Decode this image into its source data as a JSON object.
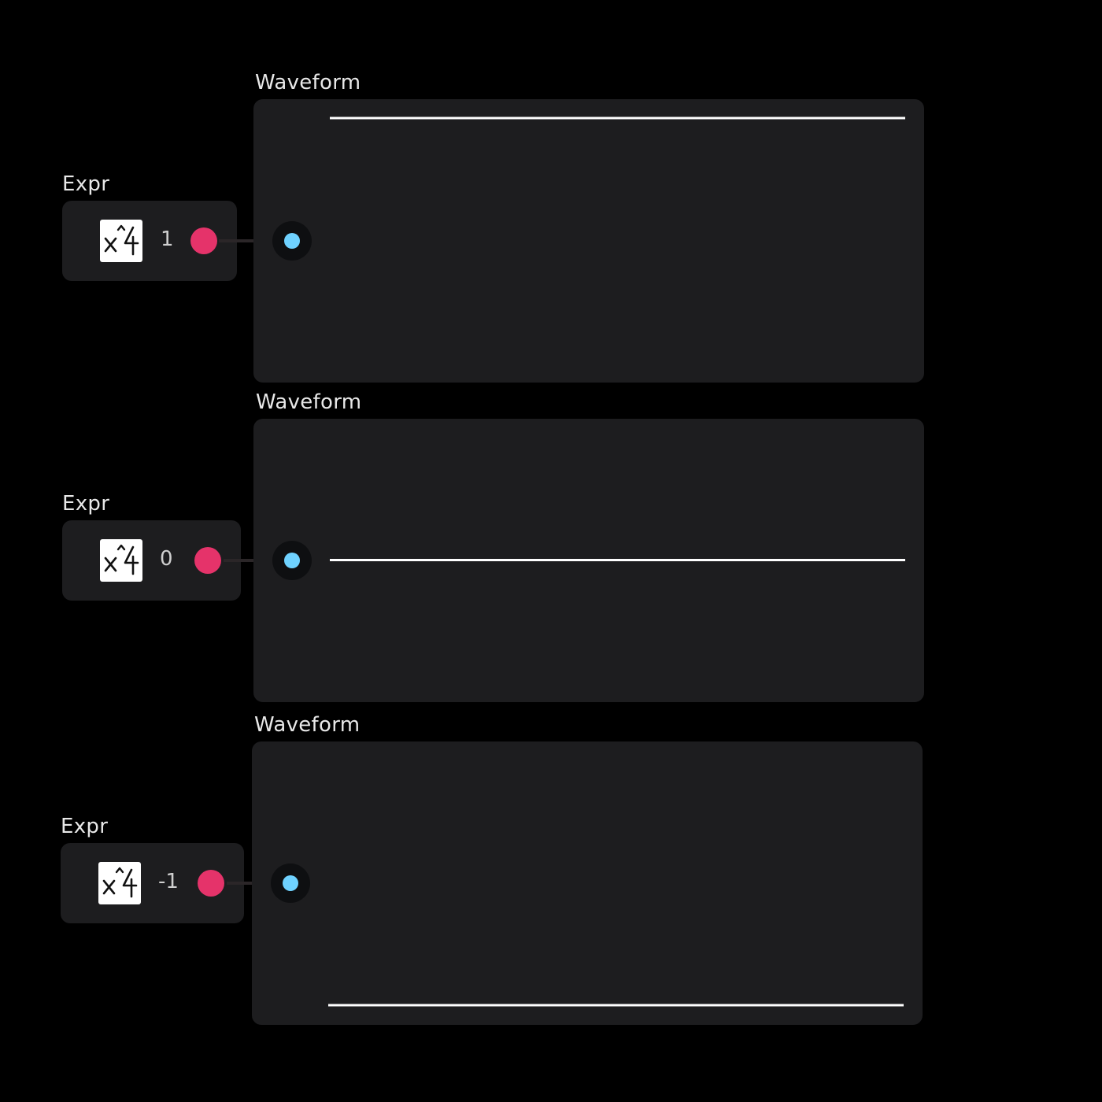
{
  "colors": {
    "background": "#000000",
    "node_bg": "#1d1d1f",
    "output_port": "#e5336a",
    "input_port": "#6fd2ff",
    "waveform_line": "#ffffff"
  },
  "rows": [
    {
      "expr": {
        "label": "Expr",
        "icon": "x-power-4-icon",
        "value": "1"
      },
      "waveform": {
        "label": "Waveform",
        "level": 1,
        "range": [
          -1,
          1
        ]
      }
    },
    {
      "expr": {
        "label": "Expr",
        "icon": "x-power-4-icon",
        "value": "0"
      },
      "waveform": {
        "label": "Waveform",
        "level": 0,
        "range": [
          -1,
          1
        ]
      }
    },
    {
      "expr": {
        "label": "Expr",
        "icon": "x-power-4-icon",
        "value": "-1"
      },
      "waveform": {
        "label": "Waveform",
        "level": -1,
        "range": [
          -1,
          1
        ]
      }
    }
  ]
}
